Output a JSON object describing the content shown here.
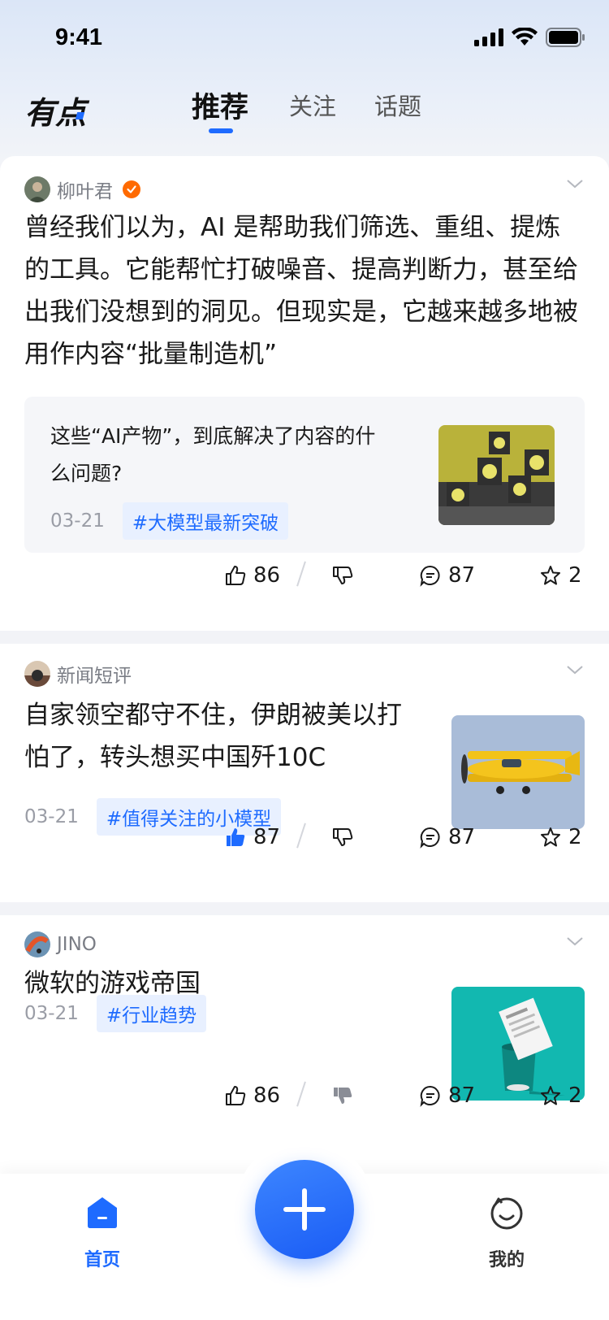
{
  "status_bar": {
    "time": "9:41"
  },
  "header": {
    "logo": "有点",
    "tabs": [
      {
        "label": "推荐",
        "active": true
      },
      {
        "label": "关注",
        "active": false
      },
      {
        "label": "话题",
        "active": false
      }
    ]
  },
  "posts": [
    {
      "author": "柳叶君",
      "verified": true,
      "title": "曾经我们以为，AI 是帮助我们筛选、重组、提炼的工具。它能帮忙打破噪音、提高判断力，甚至给出我们没想到的洞见。但现实是，它越来越多地被用作内容“批量制造机”",
      "quote": "这些“AI产物”，到底解决了内容的什么问题?",
      "date": "03-21",
      "tag": "#大模型最新突破",
      "likes": "86",
      "liked": false,
      "comments": "87",
      "favorites": "2"
    },
    {
      "author": "新闻短评",
      "title": "自家领空都守不住，伊朗被美以打怕了，转头想买中国歼10C",
      "date": "03-21",
      "tag": "#值得关注的小模型",
      "likes": "87",
      "liked": true,
      "comments": "87",
      "favorites": "2"
    },
    {
      "author": "JINO",
      "title": "微软的游戏帝国",
      "date": "03-21",
      "tag": "#行业趋势",
      "likes": "86",
      "liked": false,
      "disliked": true,
      "comments": "87",
      "favorites": "2"
    }
  ],
  "bottom_nav": {
    "home": "首页",
    "mine": "我的"
  },
  "colors": {
    "accent": "#1e6bff",
    "verified": "#ff6a00"
  }
}
